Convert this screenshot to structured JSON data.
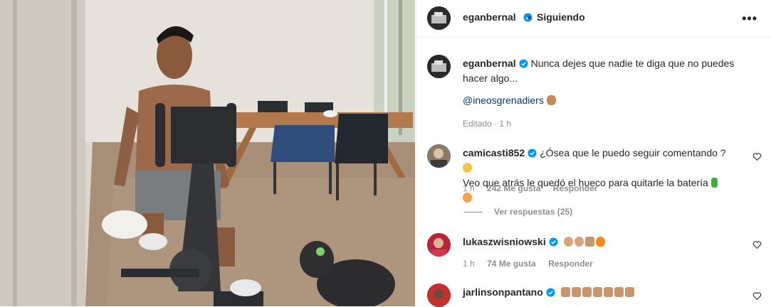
{
  "post": {
    "username": "eganbernal",
    "follow_status": "Siguiendo",
    "separator": "•",
    "more_label": "•••"
  },
  "caption": {
    "username": "eganbernal",
    "text": "Nunca dejes que nadie te diga que no puedes hacer algo...",
    "mention": "@ineosgrenadiers",
    "edited": "Editado",
    "time": "1 h"
  },
  "comments": [
    {
      "username": "camicasti852",
      "text": "¿Ósea que le puedo seguir comentando ?",
      "text2": "Veo que atrás le quedó el hueco para quitarle la batería",
      "time": "1 h",
      "likes": "242 Me gusta",
      "reply": "Responder",
      "view_replies": "Ver respuestas (25)"
    },
    {
      "username": "lukaszwisniowski",
      "time": "1 h",
      "likes": "74 Me gusta",
      "reply": "Responder"
    },
    {
      "username": "jarlinsonpantano"
    }
  ],
  "colors": {
    "verified": "#0095f6",
    "link": "#00376b",
    "secondary": "#8e8e8e"
  }
}
